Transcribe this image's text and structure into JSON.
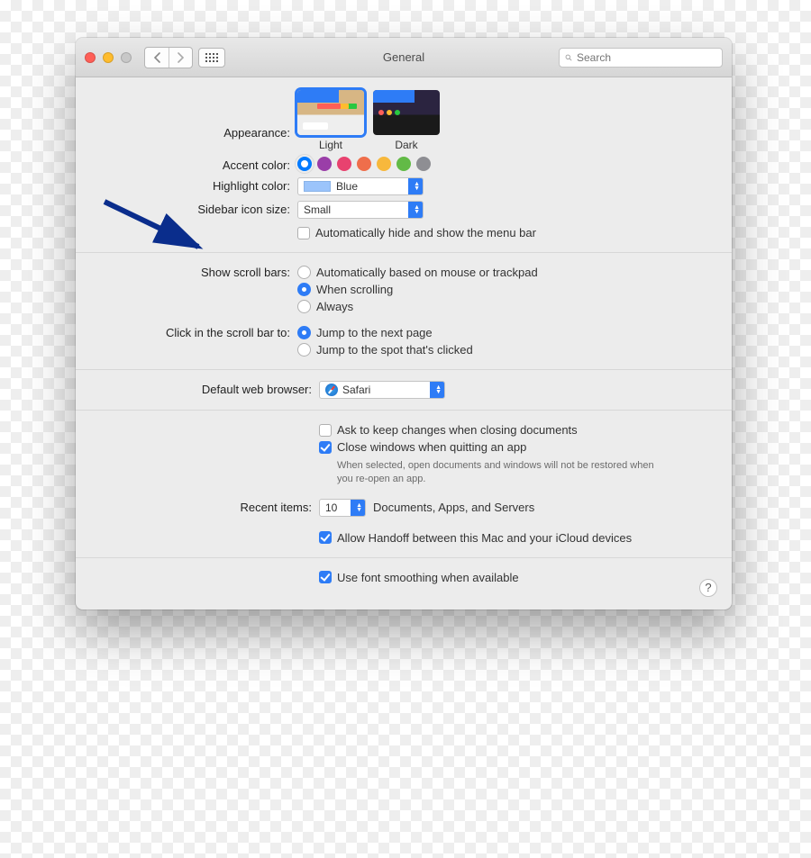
{
  "window": {
    "title": "General",
    "search_placeholder": "Search"
  },
  "appearance": {
    "label": "Appearance:",
    "light": "Light",
    "dark": "Dark"
  },
  "accent": {
    "label": "Accent color:",
    "colors": [
      "#007aff",
      "#9a3ea8",
      "#e8426f",
      "#ef6e4b",
      "#f7b83c",
      "#62ba46",
      "#8e8e93"
    ],
    "selected_index": 0
  },
  "highlight": {
    "label": "Highlight color:",
    "value": "Blue"
  },
  "sidebar": {
    "label": "Sidebar icon size:",
    "value": "Small"
  },
  "menubar_autohide": {
    "label": "Automatically hide and show the menu bar",
    "checked": false
  },
  "scrollbars": {
    "label": "Show scroll bars:",
    "opts": [
      {
        "label": "Automatically based on mouse or trackpad",
        "checked": false
      },
      {
        "label": "When scrolling",
        "checked": true
      },
      {
        "label": "Always",
        "checked": false
      }
    ]
  },
  "scrollclick": {
    "label": "Click in the scroll bar to:",
    "opts": [
      {
        "label": "Jump to the next page",
        "checked": true
      },
      {
        "label": "Jump to the spot that's clicked",
        "checked": false
      }
    ]
  },
  "browser": {
    "label": "Default web browser:",
    "value": "Safari"
  },
  "docs": {
    "ask": {
      "label": "Ask to keep changes when closing documents",
      "checked": false
    },
    "close": {
      "label": "Close windows when quitting an app",
      "checked": true
    },
    "hint": "When selected, open documents and windows will not be restored when you re-open an app."
  },
  "recent": {
    "label": "Recent items:",
    "value": "10",
    "suffix": "Documents, Apps, and Servers"
  },
  "handoff": {
    "label": "Allow Handoff between this Mac and your iCloud devices",
    "checked": true
  },
  "fontsmoothing": {
    "label": "Use font smoothing when available",
    "checked": true
  },
  "help": "?"
}
